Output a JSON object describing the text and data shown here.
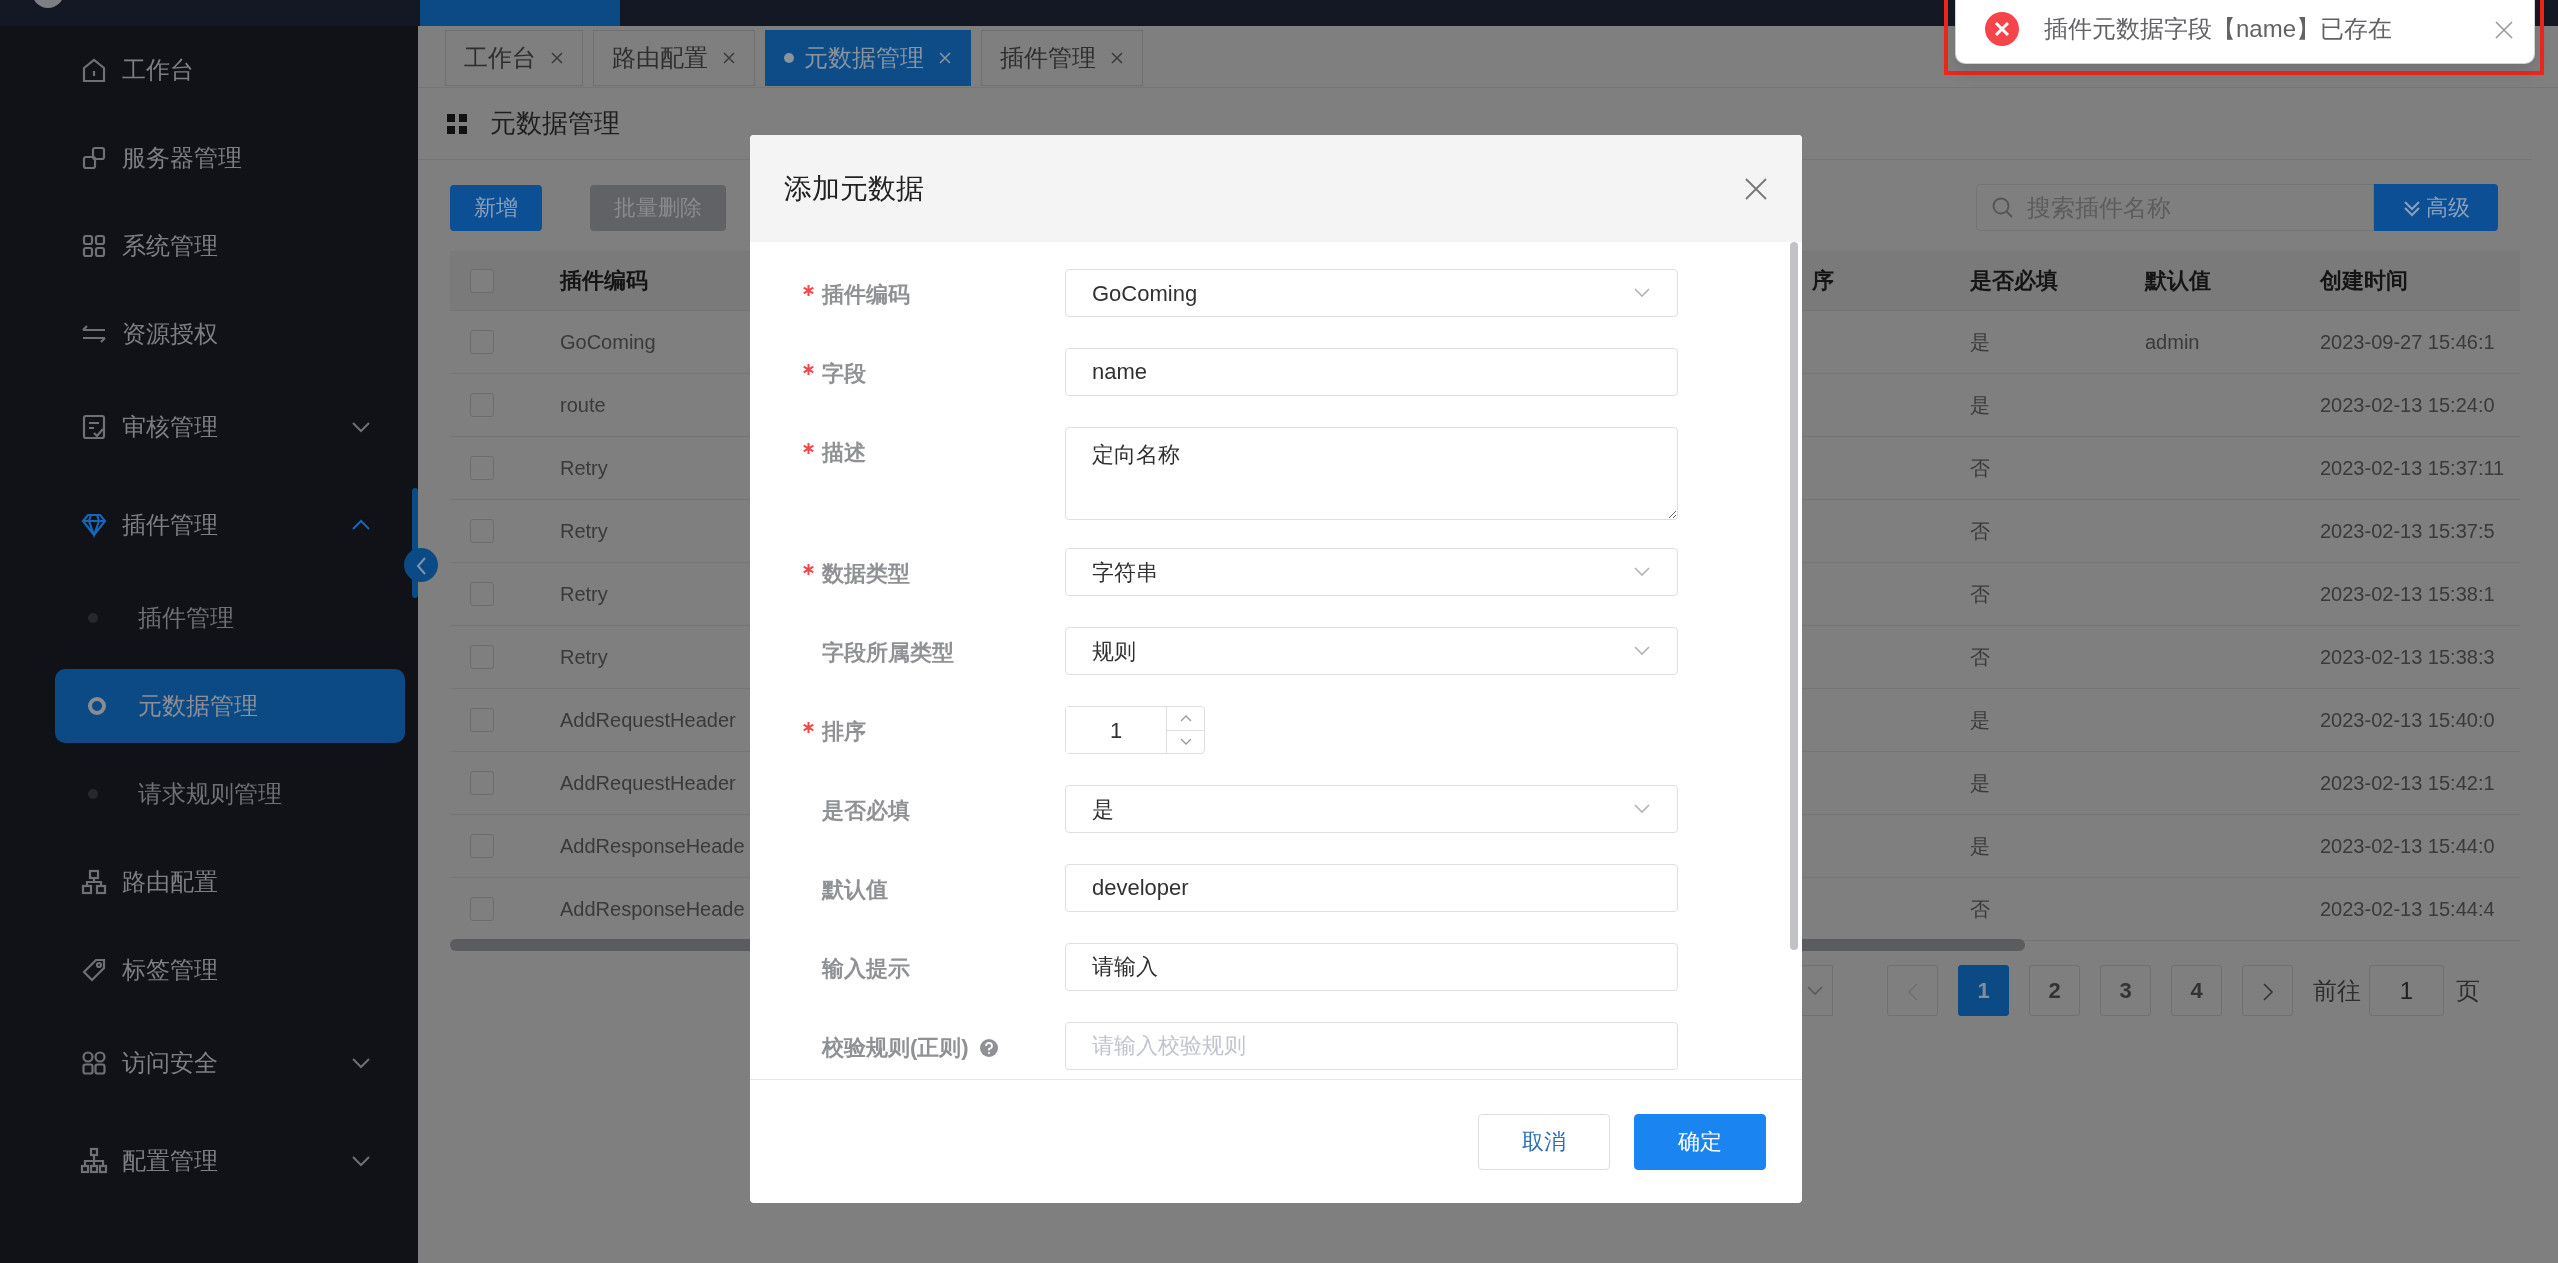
{
  "sidebar": {
    "items": [
      {
        "label": "工作台",
        "selected": false
      },
      {
        "label": "服务器管理",
        "selected": false
      },
      {
        "label": "系统管理",
        "selected": false
      },
      {
        "label": "资源授权",
        "selected": false
      },
      {
        "label": "审核管理",
        "selected": false,
        "expanded": false
      },
      {
        "label": "插件管理",
        "selected": false,
        "expanded": true,
        "children": [
          {
            "label": "插件管理",
            "selected": false
          },
          {
            "label": "元数据管理",
            "selected": true
          },
          {
            "label": "请求规则管理",
            "selected": false
          }
        ]
      },
      {
        "label": "路由配置",
        "selected": false
      },
      {
        "label": "标签管理",
        "selected": false
      },
      {
        "label": "访问安全",
        "selected": false,
        "expanded": false
      },
      {
        "label": "配置管理",
        "selected": false,
        "expanded": false
      }
    ]
  },
  "tabs": [
    {
      "label": "工作台",
      "selected": false
    },
    {
      "label": "路由配置",
      "selected": false
    },
    {
      "label": "元数据管理",
      "selected": true
    },
    {
      "label": "插件管理",
      "selected": false
    }
  ],
  "page_title": "元数据管理",
  "toolbar": {
    "buttons": [
      {
        "label": "新增",
        "disabled": false
      },
      {
        "label": "批量删除",
        "disabled": true
      }
    ],
    "search": {
      "placeholder": "搜索插件名称"
    },
    "advanced_button": "高级"
  },
  "table": {
    "select_all_checked": false,
    "columns": [
      "插件编码",
      "序",
      "是否必填",
      "默认值",
      "创建时间"
    ],
    "rows": [
      {
        "code": "GoComing",
        "required": "是",
        "default": "admin",
        "created": "2023-09-27 15:46:1",
        "checked": false
      },
      {
        "code": "route",
        "required": "是",
        "created": "2023-02-13 15:24:0",
        "checked": false
      },
      {
        "code": "Retry",
        "required": "否",
        "created": "2023-02-13 15:37:11",
        "checked": false
      },
      {
        "code": "Retry",
        "required": "否",
        "created": "2023-02-13 15:37:5",
        "checked": false
      },
      {
        "code": "Retry",
        "required": "否",
        "created": "2023-02-13 15:38:1",
        "checked": false
      },
      {
        "code": "Retry",
        "required": "否",
        "created": "2023-02-13 15:38:3",
        "checked": false
      },
      {
        "code": "AddRequestHeader",
        "required": "是",
        "created": "2023-02-13 15:40:0",
        "checked": false
      },
      {
        "code": "AddRequestHeader",
        "required": "是",
        "created": "2023-02-13 15:42:1",
        "checked": false
      },
      {
        "code": "AddResponseHeade",
        "required": "是",
        "created": "2023-02-13 15:44:0",
        "checked": false
      },
      {
        "code": "AddResponseHeade",
        "required": "否",
        "created": "2023-02-13 15:44:4",
        "checked": false
      }
    ]
  },
  "pagination": {
    "pages": [
      {
        "label": "1",
        "selected": true
      },
      {
        "label": "2",
        "selected": false
      },
      {
        "label": "3",
        "selected": false
      },
      {
        "label": "4",
        "selected": false
      }
    ],
    "goto_label": "前往",
    "goto_value": "1",
    "page_suffix": "页"
  },
  "dialog": {
    "title": "添加元数据",
    "fields": [
      {
        "label": "插件编码",
        "required": true,
        "kind": "select",
        "value": "GoComing"
      },
      {
        "label": "字段",
        "required": true,
        "kind": "input",
        "value": "name"
      },
      {
        "label": "描述",
        "required": true,
        "kind": "textarea",
        "value": "定向名称"
      },
      {
        "label": "数据类型",
        "required": true,
        "kind": "select",
        "value": "字符串"
      },
      {
        "label": "字段所属类型",
        "required": false,
        "kind": "select",
        "value": "规则"
      },
      {
        "label": "排序",
        "required": true,
        "kind": "number",
        "value": "1"
      },
      {
        "label": "是否必填",
        "required": false,
        "kind": "select",
        "value": "是"
      },
      {
        "label": "默认值",
        "required": false,
        "kind": "input",
        "value": "developer"
      },
      {
        "label": "输入提示",
        "required": false,
        "kind": "input",
        "value": "请输入"
      },
      {
        "label": "校验规则(正则)",
        "required": false,
        "kind": "input",
        "placeholder": "请输入校验规则",
        "help": true
      }
    ],
    "buttons": [
      {
        "label": "取消",
        "kind": "secondary"
      },
      {
        "label": "确定",
        "kind": "primary"
      }
    ]
  },
  "toast": {
    "message": "插件元数据字段【name】已存在"
  }
}
